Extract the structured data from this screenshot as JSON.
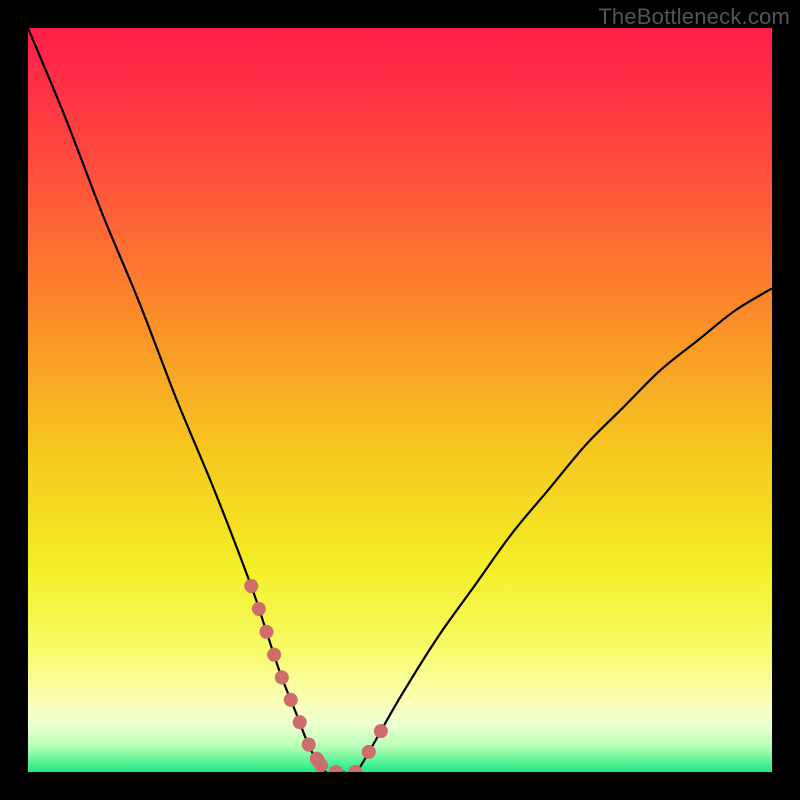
{
  "watermark": "TheBottleneck.com",
  "chart_data": {
    "type": "line",
    "title": "",
    "xlabel": "",
    "ylabel": "",
    "ylim": [
      0,
      100
    ],
    "x": [
      0,
      5,
      10,
      15,
      20,
      25,
      30,
      32,
      34,
      36,
      38,
      40,
      42,
      44,
      46,
      50,
      55,
      60,
      65,
      70,
      75,
      80,
      85,
      90,
      95,
      100
    ],
    "values": [
      100,
      88,
      75,
      63,
      50,
      38,
      25,
      19,
      13,
      8,
      3,
      0,
      0,
      0,
      3,
      10,
      18,
      25,
      32,
      38,
      44,
      49,
      54,
      58,
      62,
      65
    ],
    "flat_bottom_x_range": [
      38,
      44
    ],
    "highlight_left_x_range": [
      30,
      40
    ],
    "highlight_right_x_range": [
      44,
      48
    ],
    "highlight_color": "#cf6d6d",
    "background": {
      "type": "vertical-gradient",
      "stops": [
        {
          "pos": 0.0,
          "color": "#ff1e4a"
        },
        {
          "pos": 0.18,
          "color": "#ff4a3f"
        },
        {
          "pos": 0.38,
          "color": "#fb8a2a"
        },
        {
          "pos": 0.55,
          "color": "#f6c220"
        },
        {
          "pos": 0.72,
          "color": "#f3ee24"
        },
        {
          "pos": 0.83,
          "color": "#f7fb63"
        },
        {
          "pos": 0.9,
          "color": "#fbffb0"
        },
        {
          "pos": 0.935,
          "color": "#f0ffd0"
        },
        {
          "pos": 0.965,
          "color": "#b8ffb8"
        },
        {
          "pos": 0.985,
          "color": "#5cf598"
        },
        {
          "pos": 1.0,
          "color": "#1ee884"
        }
      ]
    }
  }
}
